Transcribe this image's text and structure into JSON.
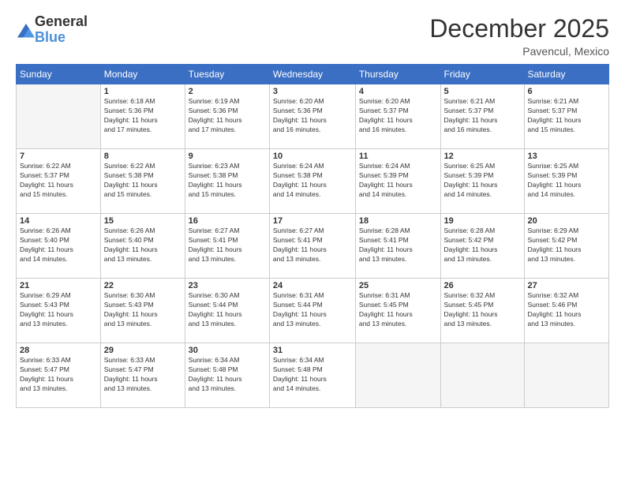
{
  "logo": {
    "line1": "General",
    "line2": "Blue"
  },
  "title": {
    "month_year": "December 2025",
    "location": "Pavencul, Mexico"
  },
  "header_days": [
    "Sunday",
    "Monday",
    "Tuesday",
    "Wednesday",
    "Thursday",
    "Friday",
    "Saturday"
  ],
  "weeks": [
    [
      {
        "day": "",
        "info": ""
      },
      {
        "day": "1",
        "info": "Sunrise: 6:18 AM\nSunset: 5:36 PM\nDaylight: 11 hours\nand 17 minutes."
      },
      {
        "day": "2",
        "info": "Sunrise: 6:19 AM\nSunset: 5:36 PM\nDaylight: 11 hours\nand 17 minutes."
      },
      {
        "day": "3",
        "info": "Sunrise: 6:20 AM\nSunset: 5:36 PM\nDaylight: 11 hours\nand 16 minutes."
      },
      {
        "day": "4",
        "info": "Sunrise: 6:20 AM\nSunset: 5:37 PM\nDaylight: 11 hours\nand 16 minutes."
      },
      {
        "day": "5",
        "info": "Sunrise: 6:21 AM\nSunset: 5:37 PM\nDaylight: 11 hours\nand 16 minutes."
      },
      {
        "day": "6",
        "info": "Sunrise: 6:21 AM\nSunset: 5:37 PM\nDaylight: 11 hours\nand 15 minutes."
      }
    ],
    [
      {
        "day": "7",
        "info": "Sunrise: 6:22 AM\nSunset: 5:37 PM\nDaylight: 11 hours\nand 15 minutes."
      },
      {
        "day": "8",
        "info": "Sunrise: 6:22 AM\nSunset: 5:38 PM\nDaylight: 11 hours\nand 15 minutes."
      },
      {
        "day": "9",
        "info": "Sunrise: 6:23 AM\nSunset: 5:38 PM\nDaylight: 11 hours\nand 15 minutes."
      },
      {
        "day": "10",
        "info": "Sunrise: 6:24 AM\nSunset: 5:38 PM\nDaylight: 11 hours\nand 14 minutes."
      },
      {
        "day": "11",
        "info": "Sunrise: 6:24 AM\nSunset: 5:39 PM\nDaylight: 11 hours\nand 14 minutes."
      },
      {
        "day": "12",
        "info": "Sunrise: 6:25 AM\nSunset: 5:39 PM\nDaylight: 11 hours\nand 14 minutes."
      },
      {
        "day": "13",
        "info": "Sunrise: 6:25 AM\nSunset: 5:39 PM\nDaylight: 11 hours\nand 14 minutes."
      }
    ],
    [
      {
        "day": "14",
        "info": "Sunrise: 6:26 AM\nSunset: 5:40 PM\nDaylight: 11 hours\nand 14 minutes."
      },
      {
        "day": "15",
        "info": "Sunrise: 6:26 AM\nSunset: 5:40 PM\nDaylight: 11 hours\nand 13 minutes."
      },
      {
        "day": "16",
        "info": "Sunrise: 6:27 AM\nSunset: 5:41 PM\nDaylight: 11 hours\nand 13 minutes."
      },
      {
        "day": "17",
        "info": "Sunrise: 6:27 AM\nSunset: 5:41 PM\nDaylight: 11 hours\nand 13 minutes."
      },
      {
        "day": "18",
        "info": "Sunrise: 6:28 AM\nSunset: 5:41 PM\nDaylight: 11 hours\nand 13 minutes."
      },
      {
        "day": "19",
        "info": "Sunrise: 6:28 AM\nSunset: 5:42 PM\nDaylight: 11 hours\nand 13 minutes."
      },
      {
        "day": "20",
        "info": "Sunrise: 6:29 AM\nSunset: 5:42 PM\nDaylight: 11 hours\nand 13 minutes."
      }
    ],
    [
      {
        "day": "21",
        "info": "Sunrise: 6:29 AM\nSunset: 5:43 PM\nDaylight: 11 hours\nand 13 minutes."
      },
      {
        "day": "22",
        "info": "Sunrise: 6:30 AM\nSunset: 5:43 PM\nDaylight: 11 hours\nand 13 minutes."
      },
      {
        "day": "23",
        "info": "Sunrise: 6:30 AM\nSunset: 5:44 PM\nDaylight: 11 hours\nand 13 minutes."
      },
      {
        "day": "24",
        "info": "Sunrise: 6:31 AM\nSunset: 5:44 PM\nDaylight: 11 hours\nand 13 minutes."
      },
      {
        "day": "25",
        "info": "Sunrise: 6:31 AM\nSunset: 5:45 PM\nDaylight: 11 hours\nand 13 minutes."
      },
      {
        "day": "26",
        "info": "Sunrise: 6:32 AM\nSunset: 5:45 PM\nDaylight: 11 hours\nand 13 minutes."
      },
      {
        "day": "27",
        "info": "Sunrise: 6:32 AM\nSunset: 5:46 PM\nDaylight: 11 hours\nand 13 minutes."
      }
    ],
    [
      {
        "day": "28",
        "info": "Sunrise: 6:33 AM\nSunset: 5:47 PM\nDaylight: 11 hours\nand 13 minutes."
      },
      {
        "day": "29",
        "info": "Sunrise: 6:33 AM\nSunset: 5:47 PM\nDaylight: 11 hours\nand 13 minutes."
      },
      {
        "day": "30",
        "info": "Sunrise: 6:34 AM\nSunset: 5:48 PM\nDaylight: 11 hours\nand 13 minutes."
      },
      {
        "day": "31",
        "info": "Sunrise: 6:34 AM\nSunset: 5:48 PM\nDaylight: 11 hours\nand 14 minutes."
      },
      {
        "day": "",
        "info": ""
      },
      {
        "day": "",
        "info": ""
      },
      {
        "day": "",
        "info": ""
      }
    ]
  ]
}
